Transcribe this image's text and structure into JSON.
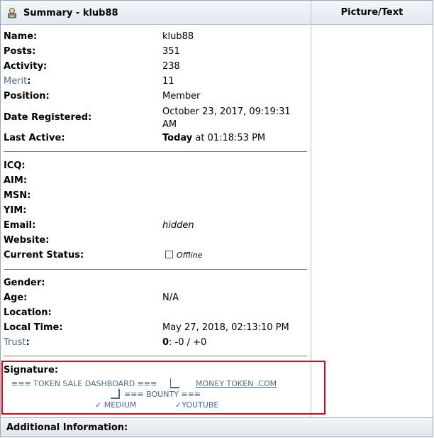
{
  "header": {
    "title": "Summary - klub88",
    "right_title": "Picture/Text"
  },
  "profile": {
    "name_label": "Name:",
    "name_value": "klub88",
    "posts_label": "Posts:",
    "posts_value": "351",
    "activity_label": "Activity:",
    "activity_value": "238",
    "merit_label": "Merit",
    "merit_value": "11",
    "position_label": "Position:",
    "position_value": "Member",
    "date_registered_label": "Date Registered:",
    "date_registered_value": "October 23, 2017, 09:19:31 AM",
    "last_active_label": "Last Active:",
    "last_active_today": "Today",
    "last_active_time": "at 01:18:53 PM"
  },
  "contact": {
    "icq_label": "ICQ:",
    "aim_label": "AIM:",
    "msn_label": "MSN:",
    "yim_label": "YIM:",
    "email_label": "Email:",
    "email_value": "hidden",
    "website_label": "Website:",
    "status_label": "Current Status:",
    "status_value": "Offline"
  },
  "details": {
    "gender_label": "Gender:",
    "age_label": "Age:",
    "age_value": "N/A",
    "location_label": "Location:",
    "local_time_label": "Local Time:",
    "local_time_value": "May 27, 2018, 02:13:10 PM",
    "trust_label": "Trust",
    "trust_score": "0",
    "trust_detail": ": -0 / +0"
  },
  "signature": {
    "label": "Signature:",
    "line1_a": "≡≡≡    TOKEN SALE DASHBOARD    ≡≡≡",
    "line1_b": "MONEY    TOKEN    .COM",
    "line2": "≡≡≡    BOUNTY    ≡≡≡",
    "line3_a": "✓ MEDIUM",
    "line3_b": "✓YOUTUBE"
  },
  "footer": {
    "additional_info": "Additional Information:"
  }
}
